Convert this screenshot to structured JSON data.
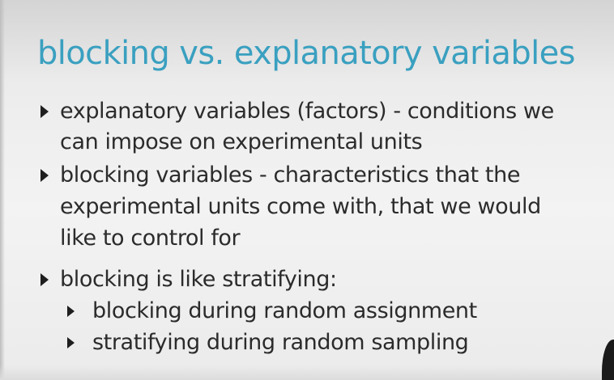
{
  "slide": {
    "title": "blocking vs. explanatory variables",
    "bullets": [
      {
        "lines": [
          "explanatory variables (factors) - conditions we",
          "can impose on experimental units"
        ]
      },
      {
        "lines": [
          "blocking variables - characteristics that the",
          "experimental units come with, that we would",
          "like to control for"
        ]
      },
      {
        "lines": [
          "blocking is like stratifying:"
        ],
        "sub_bullets": [
          "blocking during random assignment",
          "stratifying during random sampling"
        ]
      }
    ],
    "colors": {
      "title": "#3aa0c0",
      "body_text": "#2b2b2b",
      "background": "#f0f0f0"
    },
    "bullet_icon": "triangle-right-icon"
  }
}
